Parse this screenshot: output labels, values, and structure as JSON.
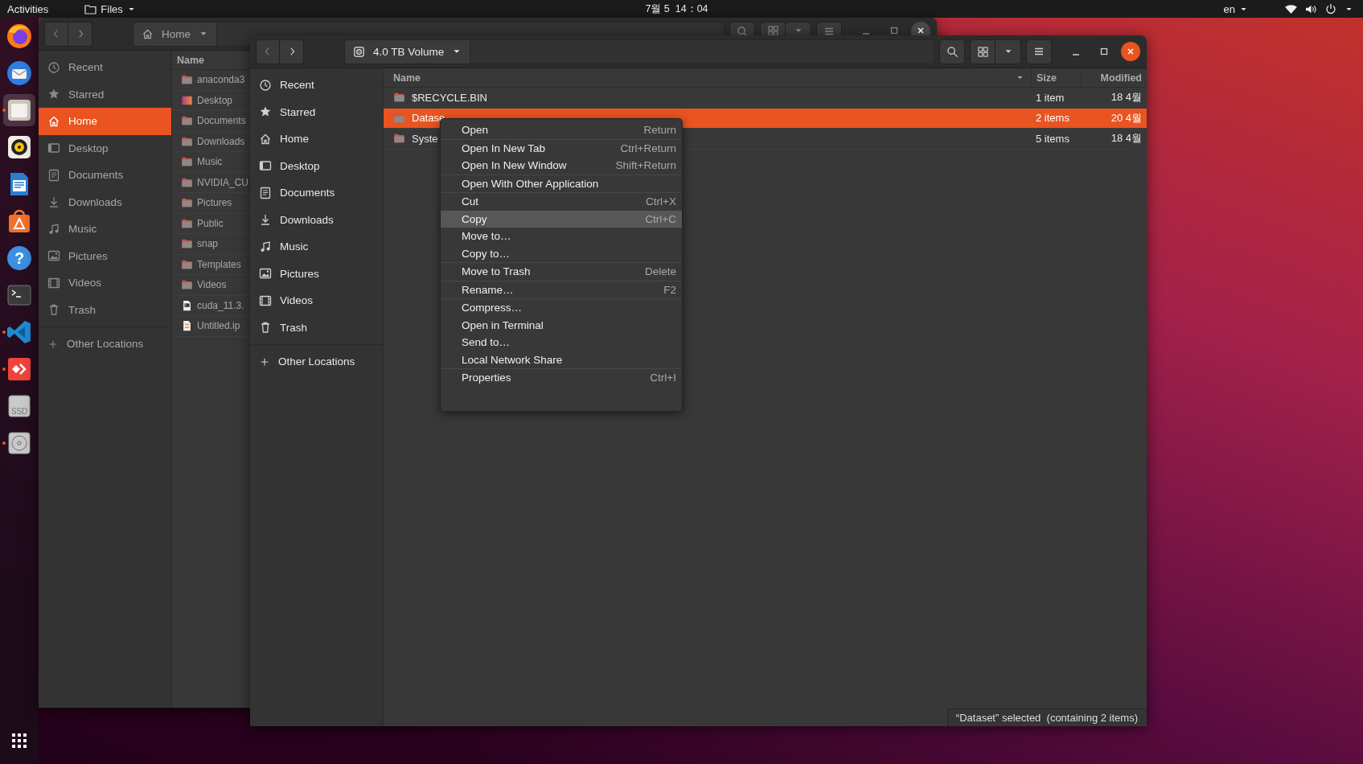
{
  "top_bar": {
    "activities": "Activities",
    "app_menu": "Files",
    "clock": "7월 5  14：04",
    "input_source": "en"
  },
  "dock": {
    "items": [
      {
        "kind": "firefox",
        "focused": false,
        "running": false
      },
      {
        "kind": "thunderbird",
        "focused": false,
        "running": false
      },
      {
        "kind": "files",
        "focused": true,
        "running": true
      },
      {
        "kind": "rhythmbox",
        "focused": false,
        "running": false
      },
      {
        "kind": "writer",
        "focused": false,
        "running": false
      },
      {
        "kind": "software",
        "focused": false,
        "running": false
      },
      {
        "kind": "help",
        "label": "?",
        "focused": false,
        "running": false
      },
      {
        "kind": "terminal",
        "focused": false,
        "running": false
      },
      {
        "kind": "vscode",
        "focused": false,
        "running": true
      },
      {
        "kind": "anydesk",
        "focused": false,
        "running": true
      },
      {
        "kind": "ssd",
        "label": "SSD",
        "focused": false,
        "running": false
      },
      {
        "kind": "disc",
        "focused": false,
        "running": true
      }
    ]
  },
  "back_window": {
    "focused": false,
    "back_disabled": true,
    "forward_disabled": false,
    "location": {
      "kind": "home",
      "label": "Home"
    },
    "sidebar": [
      {
        "kind": "recent",
        "label": "Recent",
        "selected": false
      },
      {
        "kind": "starred",
        "label": "Starred",
        "selected": false
      },
      {
        "kind": "home",
        "label": "Home",
        "selected": true
      },
      {
        "kind": "desktop",
        "label": "Desktop",
        "selected": false
      },
      {
        "kind": "documents",
        "label": "Documents",
        "selected": false
      },
      {
        "kind": "downloads",
        "label": "Downloads",
        "selected": false
      },
      {
        "kind": "music",
        "label": "Music",
        "selected": false
      },
      {
        "kind": "pictures",
        "label": "Pictures",
        "selected": false
      },
      {
        "kind": "videos",
        "label": "Videos",
        "selected": false
      },
      {
        "kind": "trash",
        "label": "Trash",
        "selected": false
      }
    ],
    "other_locations": "Other Locations",
    "columns": [
      {
        "label": "Name",
        "sorted": false
      }
    ],
    "files": [
      {
        "kind": "folder",
        "name": "anaconda3",
        "selected": false
      },
      {
        "kind": "desktop-folder",
        "name": "Desktop",
        "selected": false
      },
      {
        "kind": "folder",
        "name": "Documents",
        "selected": false
      },
      {
        "kind": "folder",
        "name": "Downloads",
        "selected": false
      },
      {
        "kind": "folder",
        "name": "Music",
        "selected": false
      },
      {
        "kind": "folder",
        "name": "NVIDIA_CU",
        "selected": false
      },
      {
        "kind": "folder",
        "name": "Pictures",
        "selected": false
      },
      {
        "kind": "folder",
        "name": "Public",
        "selected": false
      },
      {
        "kind": "folder",
        "name": "snap",
        "selected": false
      },
      {
        "kind": "folder",
        "name": "Templates",
        "selected": false
      },
      {
        "kind": "folder",
        "name": "Videos",
        "selected": false
      },
      {
        "kind": "script",
        "name": "cuda_11.3.",
        "selected": false
      },
      {
        "kind": "notebook",
        "name": "Untitled.ip",
        "selected": false
      }
    ]
  },
  "front_window": {
    "focused": true,
    "back_disabled": true,
    "forward_disabled": false,
    "location": {
      "kind": "disk",
      "label": "4.0 TB Volume"
    },
    "sidebar": [
      {
        "kind": "recent",
        "label": "Recent",
        "selected": false
      },
      {
        "kind": "starred",
        "label": "Starred",
        "selected": false
      },
      {
        "kind": "home",
        "label": "Home",
        "selected": false
      },
      {
        "kind": "desktop",
        "label": "Desktop",
        "selected": false
      },
      {
        "kind": "documents",
        "label": "Documents",
        "selected": false
      },
      {
        "kind": "downloads",
        "label": "Downloads",
        "selected": false
      },
      {
        "kind": "music",
        "label": "Music",
        "selected": false
      },
      {
        "kind": "pictures",
        "label": "Pictures",
        "selected": false
      },
      {
        "kind": "videos",
        "label": "Videos",
        "selected": false
      },
      {
        "kind": "trash",
        "label": "Trash",
        "selected": false
      }
    ],
    "other_locations": "Other Locations",
    "columns": [
      {
        "label": "Name",
        "sorted": true
      },
      {
        "label": "Size",
        "sorted": false
      },
      {
        "label": "Modified",
        "sorted": false
      }
    ],
    "files": [
      {
        "kind": "folder",
        "name": "$RECYCLE.BIN",
        "size": "1 item",
        "modified": "18 4월",
        "selected": false
      },
      {
        "kind": "folder",
        "name": "Datase",
        "size": "2 items",
        "modified": "20 4월",
        "selected": true
      },
      {
        "kind": "folder",
        "name": "Syste",
        "size": "5 items",
        "modified": "18 4월",
        "selected": false
      }
    ],
    "status": "“Dataset” selected  (containing 2 items)"
  },
  "context_menu": {
    "sections": [
      [
        {
          "label": "Open",
          "shortcut": "Return",
          "selected": false
        }
      ],
      [
        {
          "label": "Open In New Tab",
          "shortcut": "Ctrl+Return",
          "selected": false
        },
        {
          "label": "Open In New Window",
          "shortcut": "Shift+Return",
          "selected": false
        }
      ],
      [
        {
          "label": "Open With Other Application",
          "selected": false
        }
      ],
      [
        {
          "label": "Cut",
          "shortcut": "Ctrl+X",
          "selected": false
        },
        {
          "label": "Copy",
          "shortcut": "Ctrl+C",
          "selected": true
        },
        {
          "label": "Move to…",
          "selected": false
        },
        {
          "label": "Copy to…",
          "selected": false
        }
      ],
      [
        {
          "label": "Move to Trash",
          "shortcut": "Delete",
          "selected": false
        }
      ],
      [
        {
          "label": "Rename…",
          "shortcut": "F2",
          "selected": false
        }
      ],
      [
        {
          "label": "Compress…",
          "selected": false
        },
        {
          "label": "Open in Terminal",
          "selected": false
        },
        {
          "label": "Send to…",
          "selected": false
        },
        {
          "label": "Local Network Share",
          "selected": false
        }
      ],
      [
        {
          "label": "Properties",
          "shortcut": "Ctrl+I",
          "selected": false
        }
      ]
    ]
  }
}
